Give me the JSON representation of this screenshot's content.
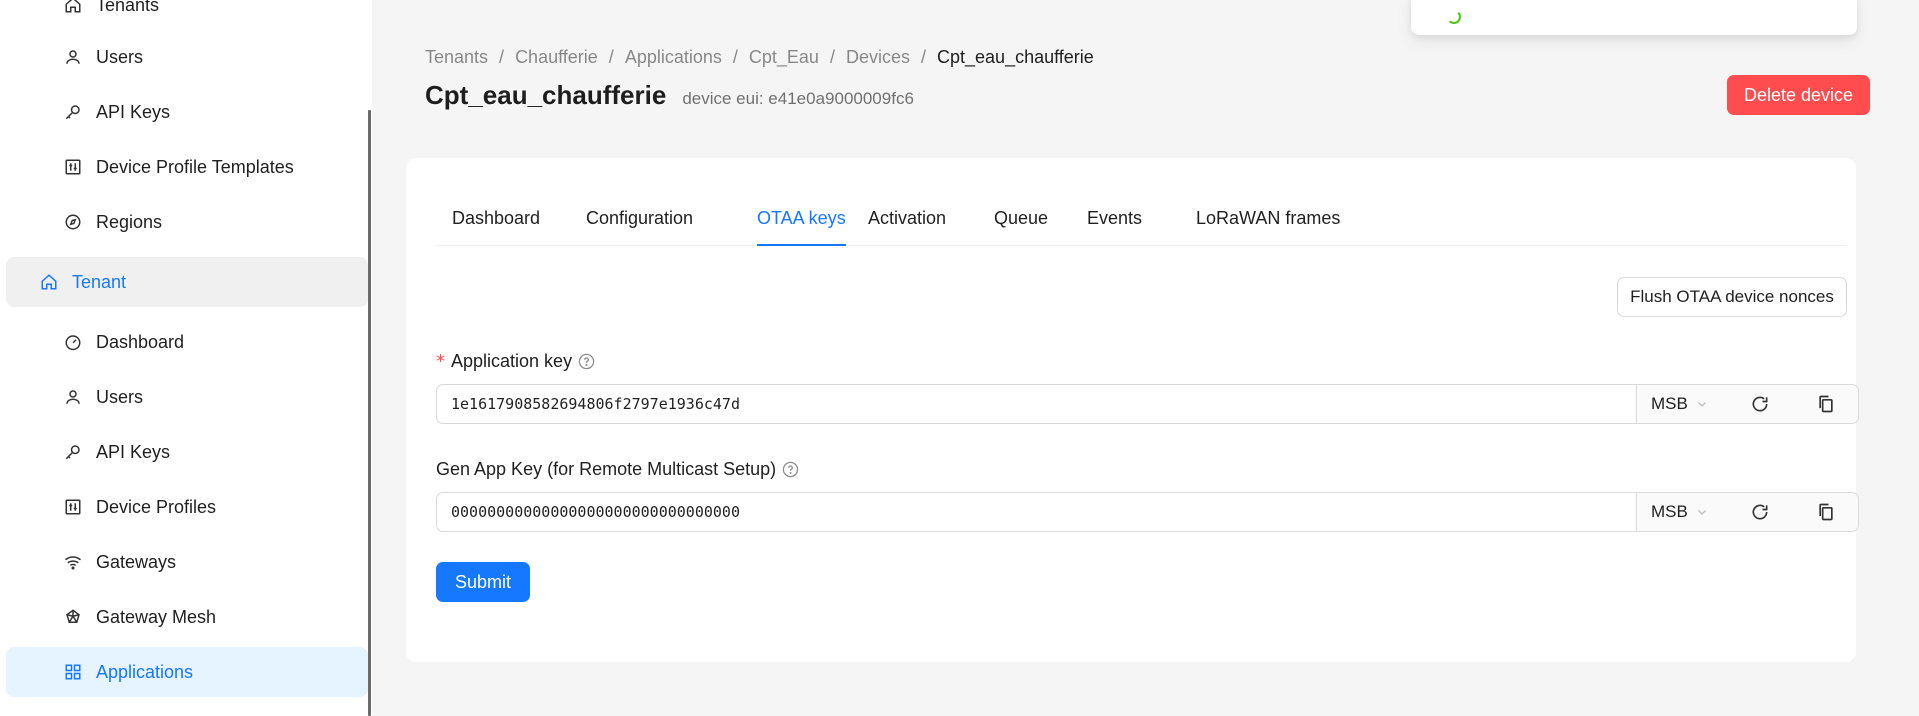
{
  "sidebar": {
    "items": [
      {
        "label": "Tenants",
        "icon": "home-icon"
      },
      {
        "label": "Users",
        "icon": "user-icon"
      },
      {
        "label": "API Keys",
        "icon": "key-icon"
      },
      {
        "label": "Device Profile Templates",
        "icon": "sliders-icon"
      },
      {
        "label": "Regions",
        "icon": "compass-icon"
      },
      {
        "label": "Tenant",
        "icon": "home-icon"
      },
      {
        "label": "Dashboard",
        "icon": "dashboard-icon"
      },
      {
        "label": "Users",
        "icon": "user-icon"
      },
      {
        "label": "API Keys",
        "icon": "key-icon"
      },
      {
        "label": "Device Profiles",
        "icon": "sliders-icon"
      },
      {
        "label": "Gateways",
        "icon": "wifi-icon"
      },
      {
        "label": "Gateway Mesh",
        "icon": "mesh-icon"
      },
      {
        "label": "Applications",
        "icon": "appstore-icon"
      }
    ]
  },
  "breadcrumb": [
    "Tenants",
    "Chaufferie",
    "Applications",
    "Cpt_Eau",
    "Devices",
    "Cpt_eau_chaufferie"
  ],
  "header": {
    "title": "Cpt_eau_chaufferie",
    "subtitle": "device eui: e41e0a9000009fc6",
    "delete_label": "Delete device"
  },
  "tabs": [
    "Dashboard",
    "Configuration",
    "OTAA keys",
    "Activation",
    "Queue",
    "Events",
    "LoRaWAN frames"
  ],
  "active_tab": "OTAA keys",
  "form": {
    "flush_label": "Flush OTAA device nonces",
    "app_key_label": "Application key",
    "app_key_value": "1e1617908582694806f2797e1936c47d",
    "app_key_order": "MSB",
    "gen_app_key_label": "Gen App Key (for Remote Multicast Setup)",
    "gen_app_key_value": "00000000000000000000000000000000",
    "gen_app_key_order": "MSB",
    "submit_label": "Submit"
  },
  "colors": {
    "primary": "#1677ff",
    "danger": "#ff4d4f",
    "active_bg": "#e6f4ff"
  }
}
